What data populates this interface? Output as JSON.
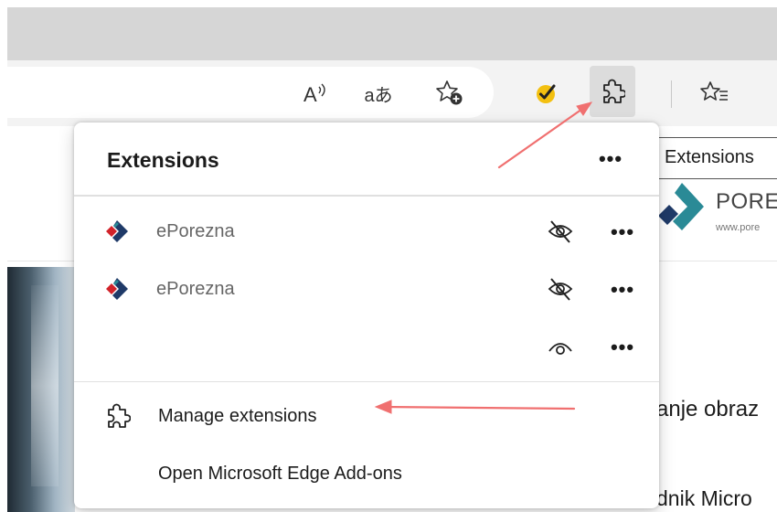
{
  "toolbar": {
    "read_aloud_glyph": "A⁾",
    "translate_glyph": "aあ",
    "icons": [
      "read-aloud-icon",
      "translate-icon",
      "add-favorite-icon",
      "extension-checkmark-icon",
      "extensions-puzzle-icon",
      "favorites-icon"
    ]
  },
  "tooltip": {
    "text": "Extensions"
  },
  "panel": {
    "title": "Extensions",
    "more_glyph": "•••",
    "extensions": [
      {
        "name": "ePorezna",
        "visibility": "hidden-from-toolbar"
      },
      {
        "name": "ePorezna",
        "visibility": "hidden-from-toolbar"
      },
      {
        "name": "",
        "visibility": "shown-in-toolbar"
      }
    ],
    "manage_label": "Manage extensions",
    "addons_label": "Open Microsoft Edge Add-ons"
  },
  "page": {
    "logo_name": "PORE",
    "logo_url": "www.pore",
    "heading": "anje obraz",
    "text": "dnik  Micro"
  },
  "colors": {
    "annotation_arrow": "#f07070",
    "accent_yellow": "#f3c010",
    "logo_teal": "#2a8a96",
    "logo_red": "#d2232a",
    "logo_navy": "#1f3a68"
  }
}
